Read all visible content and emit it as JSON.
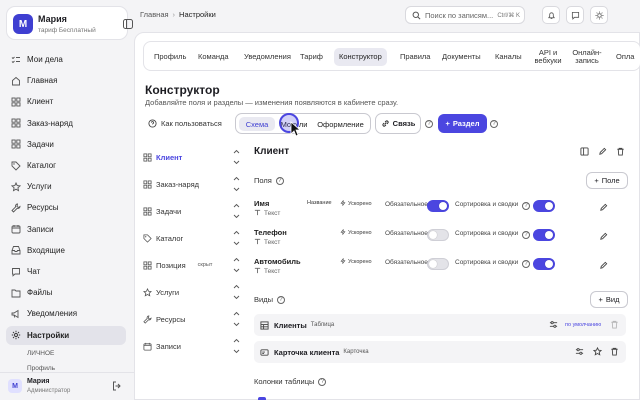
{
  "org": {
    "initial": "М",
    "name": "Мария",
    "plan": "тариф Бесплатный"
  },
  "nav": [
    {
      "label": "Мои дела",
      "icon": "checklist-icon"
    },
    {
      "label": "Главная",
      "icon": "home-icon"
    },
    {
      "label": "Клиент",
      "icon": "grid-icon"
    },
    {
      "label": "Заказ-наряд",
      "icon": "grid-icon"
    },
    {
      "label": "Задачи",
      "icon": "grid-icon"
    },
    {
      "label": "Каталог",
      "icon": "tag-icon"
    },
    {
      "label": "Услуги",
      "icon": "star-icon"
    },
    {
      "label": "Ресурсы",
      "icon": "wrench-icon"
    },
    {
      "label": "Записи",
      "icon": "calendar-icon"
    },
    {
      "label": "Входящие",
      "icon": "inbox-icon"
    },
    {
      "label": "Чат",
      "icon": "chat-icon"
    },
    {
      "label": "Файлы",
      "icon": "folder-icon"
    },
    {
      "label": "Уведомления",
      "icon": "megaphone-icon"
    },
    {
      "label": "Настройки",
      "icon": "gear-icon"
    }
  ],
  "nav_sub": [
    "ЛИЧНОЕ",
    "Профиль"
  ],
  "user": {
    "initial": "М",
    "name": "Мария",
    "role": "Администратор"
  },
  "breadcrumb": {
    "home": "Главная",
    "current": "Настройки"
  },
  "search": {
    "placeholder": "Поиск по записям...",
    "shortcut": "Ctrl/⌘ K"
  },
  "tabs": [
    "Профиль",
    "Команда",
    "Уведомления",
    "Тариф",
    "Конструктор",
    "Правила",
    "Документы",
    "Каналы",
    "API и вебхуки",
    "Онлайн-запись",
    "Опла"
  ],
  "active_tab": "Конструктор",
  "page": {
    "title": "Конструктор",
    "subtitle": "Добавляйте поля и разделы — изменения появляются в кабинете сразу."
  },
  "toolbar": {
    "howto": "Как пользоваться",
    "segments": [
      "Схема",
      "Модули",
      "Оформление"
    ],
    "link": "Связь",
    "section": "Раздел"
  },
  "entities": [
    {
      "label": "Клиент",
      "icon": "grid-icon",
      "badge": ""
    },
    {
      "label": "Заказ-наряд",
      "icon": "grid-icon",
      "badge": ""
    },
    {
      "label": "Задачи",
      "icon": "grid-icon",
      "badge": ""
    },
    {
      "label": "Каталог",
      "icon": "tag-icon",
      "badge": ""
    },
    {
      "label": "Позиция",
      "icon": "grid-icon",
      "badge": "скрыт"
    },
    {
      "label": "Услуги",
      "icon": "star-icon",
      "badge": ""
    },
    {
      "label": "Ресурсы",
      "icon": "wrench-icon",
      "badge": ""
    },
    {
      "label": "Записи",
      "icon": "calendar-icon",
      "badge": ""
    }
  ],
  "detail": {
    "title": "Клиент",
    "fields_label": "Поля",
    "add_field": "Поле",
    "required_label": "Обязательное",
    "sort_label": "Сортировка и сводки",
    "fields": [
      {
        "name": "Имя",
        "type": "Текст",
        "tag": "Название",
        "accel": "Ускорено",
        "required": true,
        "sort": true
      },
      {
        "name": "Телефон",
        "type": "Текст",
        "tag": "",
        "accel": "Ускорено",
        "required": false,
        "sort": true
      },
      {
        "name": "Автомобиль",
        "type": "Текст",
        "tag": "",
        "accel": "Ускорено",
        "required": false,
        "sort": true
      }
    ],
    "views_label": "Виды",
    "add_view": "Вид",
    "views": [
      {
        "name": "Клиенты",
        "kind": "Таблица",
        "badge": "по умолчанию"
      },
      {
        "name": "Карточка клиента",
        "kind": "Карточка",
        "badge": ""
      }
    ],
    "columns_label": "Колонки таблицы"
  },
  "colors": {
    "accent": "#4b46e0",
    "sidebar_bg": "#f4f4f6"
  }
}
